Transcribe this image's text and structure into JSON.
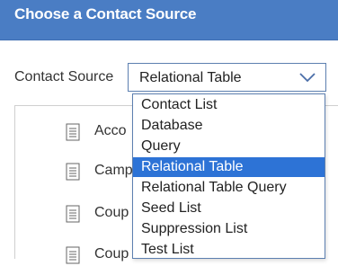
{
  "dialog": {
    "title": "Choose a Contact Source"
  },
  "form": {
    "label": "Contact Source",
    "selected_value": "Relational Table"
  },
  "dropdown": {
    "options": [
      "Contact List",
      "Database",
      "Query",
      "Relational Table",
      "Relational Table Query",
      "Seed List",
      "Suppression List",
      "Test List"
    ],
    "selected_index": 3
  },
  "tree": {
    "items": [
      {
        "label": "Acco",
        "icon": "document-icon"
      },
      {
        "label": "Camp",
        "icon": "document-icon"
      },
      {
        "label": "Coup",
        "icon": "document-icon"
      },
      {
        "label": "Coup",
        "icon": "document-icon"
      }
    ]
  },
  "colors": {
    "header_bg": "#4a7dc4",
    "selection_bg": "#2d73d6",
    "select_border": "#5c7fb0"
  }
}
